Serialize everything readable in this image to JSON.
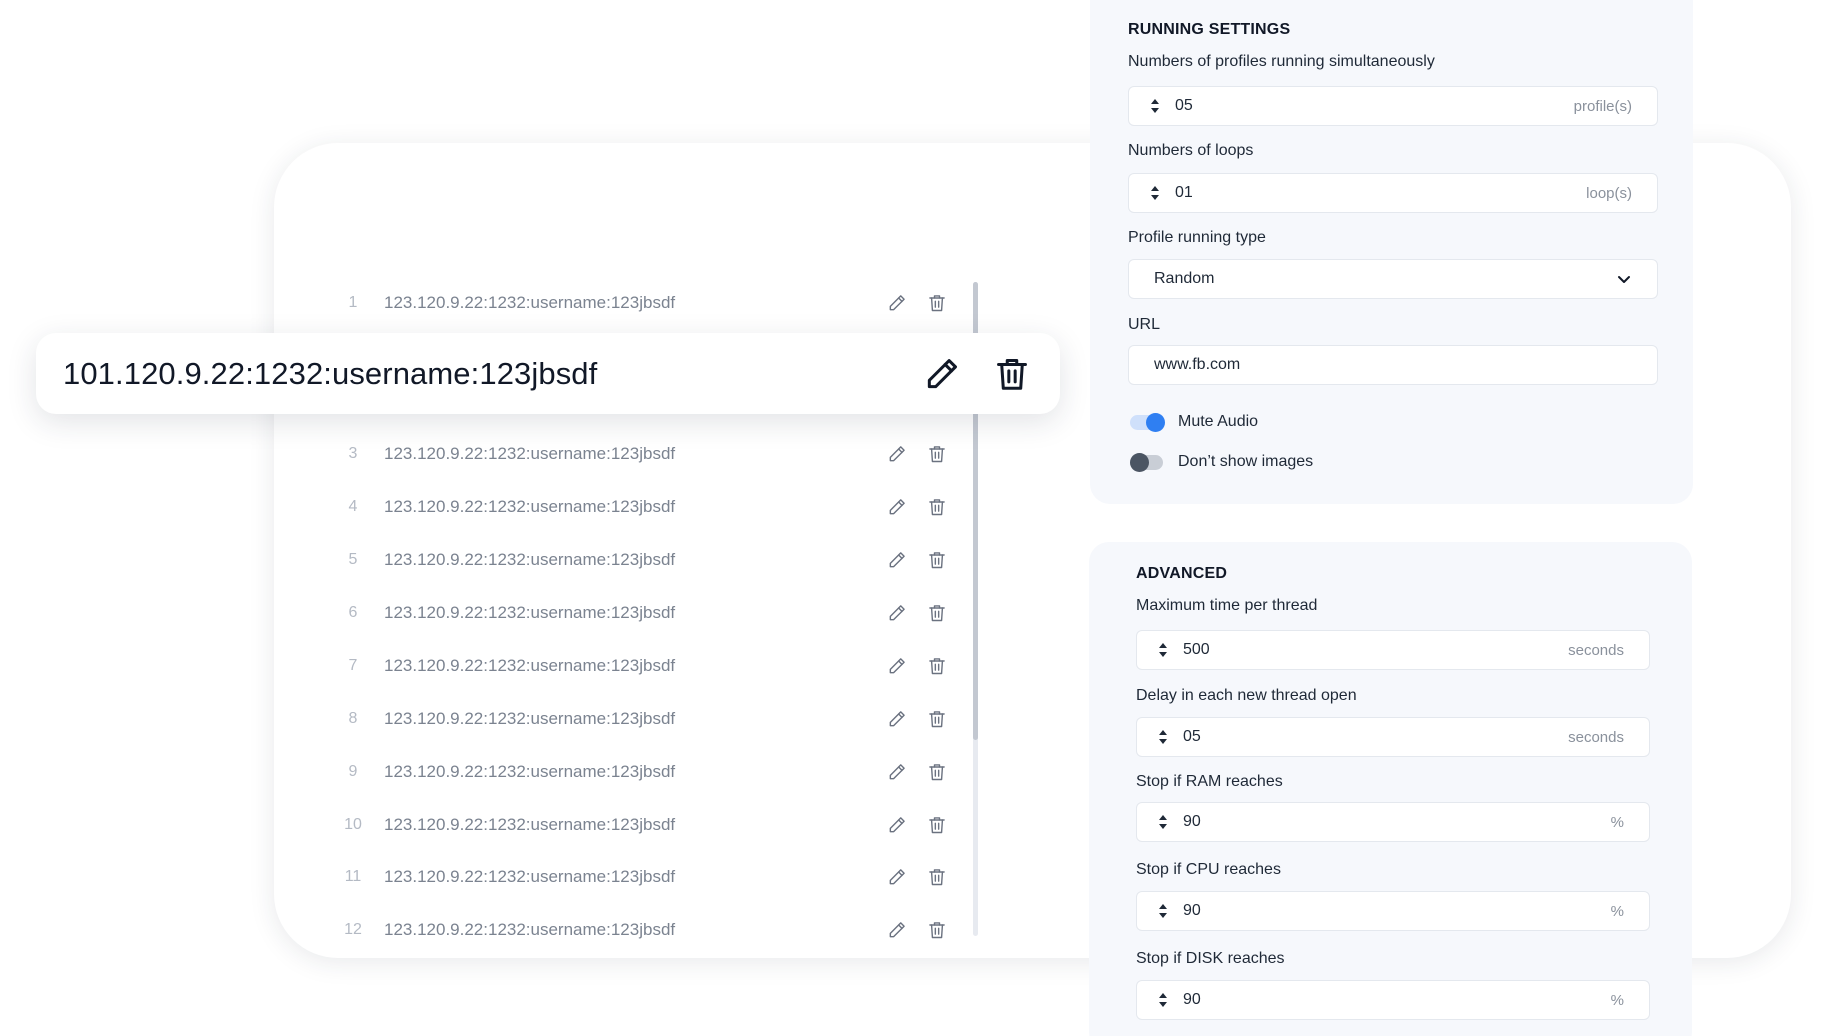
{
  "proxy_list": {
    "rows": [
      {
        "index": "1",
        "value": "123.120.9.22:1232:username:123jbsdf"
      },
      {
        "index": "3",
        "value": "123.120.9.22:1232:username:123jbsdf"
      },
      {
        "index": "4",
        "value": "123.120.9.22:1232:username:123jbsdf"
      },
      {
        "index": "5",
        "value": "123.120.9.22:1232:username:123jbsdf"
      },
      {
        "index": "6",
        "value": "123.120.9.22:1232:username:123jbsdf"
      },
      {
        "index": "7",
        "value": "123.120.9.22:1232:username:123jbsdf"
      },
      {
        "index": "8",
        "value": "123.120.9.22:1232:username:123jbsdf"
      },
      {
        "index": "9",
        "value": "123.120.9.22:1232:username:123jbsdf"
      },
      {
        "index": "10",
        "value": "123.120.9.22:1232:username:123jbsdf"
      },
      {
        "index": "11",
        "value": "123.120.9.22:1232:username:123jbsdf"
      },
      {
        "index": "12",
        "value": "123.120.9.22:1232:username:123jbsdf"
      }
    ],
    "highlighted": {
      "value": "101.120.9.22:1232:username:123jbsdf"
    },
    "icons": {
      "edit": "pencil-icon",
      "delete": "trash-icon"
    }
  },
  "running_settings": {
    "title": "RUNNING SETTINGS",
    "profiles": {
      "label": "Numbers of profiles running simultaneously",
      "value": "05",
      "unit": "profile(s)"
    },
    "loops": {
      "label": "Numbers of loops",
      "value": "01",
      "unit": "loop(s)"
    },
    "running_type": {
      "label": "Profile running type",
      "value": "Random"
    },
    "url": {
      "label": "URL",
      "value": "www.fb.com"
    },
    "mute_audio": {
      "label": "Mute Audio",
      "enabled": true
    },
    "dont_show_images": {
      "label": "Don’t show images",
      "enabled": false
    }
  },
  "advanced": {
    "title": "ADVANCED",
    "max_time": {
      "label": "Maximum time per thread",
      "value": "500",
      "unit": "seconds"
    },
    "delay": {
      "label": "Delay in each new thread open",
      "value": "05",
      "unit": "seconds"
    },
    "ram": {
      "label": "Stop if RAM reaches",
      "value": "90",
      "unit": "%"
    },
    "cpu": {
      "label": "Stop if CPU reaches",
      "value": "90",
      "unit": "%"
    },
    "disk": {
      "label": "Stop if DISK reaches",
      "value": "90",
      "unit": "%"
    }
  },
  "colors": {
    "accent": "#2f7ff2",
    "panel_bg": "#f6f8fc",
    "muted_text": "#7b8390"
  }
}
